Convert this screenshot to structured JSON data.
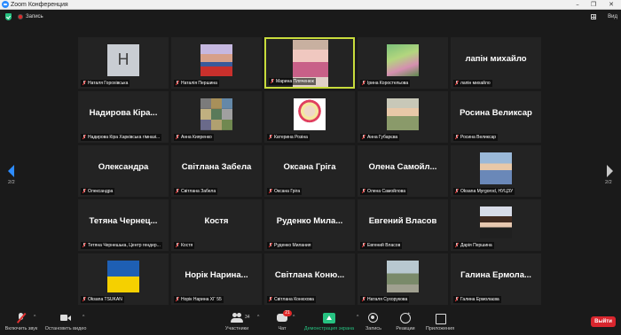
{
  "window": {
    "title": "Zoom Конференция",
    "controls": [
      "–",
      "❐",
      "✕"
    ]
  },
  "infobar": {
    "recording_label": "Запись",
    "view_label": "Вид"
  },
  "colors": {
    "accent": "#2d8cff",
    "active_speaker_border": "#c8dc3c",
    "share_green": "#26c281",
    "leave_red": "#d9262e"
  },
  "pagination": {
    "left": "2/2",
    "right": "2/2"
  },
  "participants": [
    {
      "name": "Наталя Горохівська",
      "display": "",
      "avatar": "letter",
      "letter": "Н"
    },
    {
      "name": "Наталія Першина",
      "display": "",
      "avatar": "photo"
    },
    {
      "name": "Марина Пляченюк",
      "display": "",
      "avatar": "video",
      "active": true
    },
    {
      "name": "Ірина Коростельова",
      "display": "",
      "avatar": "photo"
    },
    {
      "name": "лапін михайло",
      "display": "лапін михайло",
      "avatar": "none"
    },
    {
      "name": "Надирова Кіра Харківська гімназі...",
      "display": "Надирова Кіра...",
      "avatar": "none"
    },
    {
      "name": "Анна Кияренко",
      "display": "",
      "avatar": "photo"
    },
    {
      "name": "Катерина Розіна",
      "display": "",
      "avatar": "photo"
    },
    {
      "name": "Анна Губарєва",
      "display": "",
      "avatar": "photo"
    },
    {
      "name": "Росина Великсар",
      "display": "Росина Великсар",
      "avatar": "none"
    },
    {
      "name": "Олександра",
      "display": "Олександра",
      "avatar": "none"
    },
    {
      "name": "Світлана Забела",
      "display": "Світлана Забела",
      "avatar": "none"
    },
    {
      "name": "Оксана Гріга",
      "display": "Оксана Гріга",
      "avatar": "none"
    },
    {
      "name": "Олена Самойлова",
      "display": "Олена Самойл...",
      "avatar": "none"
    },
    {
      "name": "Oksana Myrgorod, НУЦЗУ",
      "display": "",
      "avatar": "photo"
    },
    {
      "name": "Тетяна Чернешька, Центр гендер...",
      "display": "Тетяна Чернец...",
      "avatar": "none"
    },
    {
      "name": "Костя",
      "display": "Костя",
      "avatar": "none"
    },
    {
      "name": "Руденко Милания",
      "display": "Руденко Мила...",
      "avatar": "none"
    },
    {
      "name": "Евгений Власов",
      "display": "Евгений Власов",
      "avatar": "none"
    },
    {
      "name": "Дарія Першина",
      "display": "",
      "avatar": "photo"
    },
    {
      "name": "Oksana TSUKAN",
      "display": "",
      "avatar": "flag"
    },
    {
      "name": "Норік Нарина ХГ 55",
      "display": "Норік Нарина...",
      "avatar": "none"
    },
    {
      "name": "Світлана Конюхова",
      "display": "Світлана Коню...",
      "avatar": "none"
    },
    {
      "name": "Наталя Сухорукова",
      "display": "",
      "avatar": "photo"
    },
    {
      "name": "Галина Ермолаєва",
      "display": "Галина Ермола...",
      "avatar": "none"
    }
  ],
  "toolbar": {
    "unmute_label": "Включить звук",
    "video_label": "Остановить видео",
    "participants_label": "Участники",
    "participants_count": "34",
    "chat_label": "Чат",
    "chat_badge": "21",
    "share_label": "Демонстрация экрана",
    "record_label": "Запись",
    "reactions_label": "Реакции",
    "apps_label": "Приложения",
    "leave_label": "Выйти",
    "caret": "^"
  }
}
